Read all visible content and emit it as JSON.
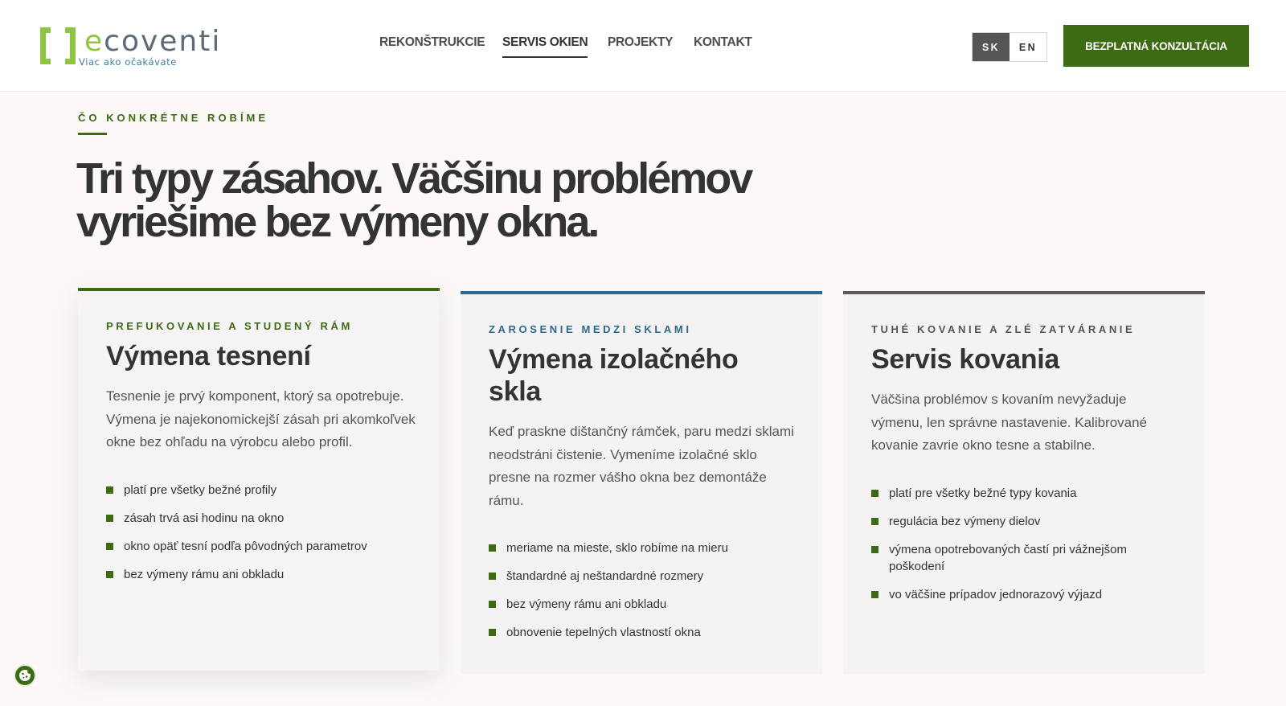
{
  "brand": {
    "logo_word_accent": "e",
    "logo_word_rest": "coventi",
    "tagline": "Viac ako očakávate",
    "colors": {
      "green": "#3d6b12",
      "lime": "#8dc63f",
      "blue": "#2b6a8e",
      "gray": "#5a5a5a"
    }
  },
  "nav": {
    "items": [
      {
        "label": "REKONŠTRUKCIE",
        "active": false
      },
      {
        "label": "SERVIS OKIEN",
        "active": true
      },
      {
        "label": "PROJEKTY",
        "active": false
      },
      {
        "label": "KONTAKT",
        "active": false
      }
    ]
  },
  "language": {
    "sk": "SK",
    "en": "EN",
    "selected": "SK"
  },
  "cta": {
    "label": "BEZPLATNÁ KONZULTÁCIA"
  },
  "section": {
    "eyebrow": "ČO KONKRÉTNE ROBÍME",
    "headline": "Tri typy zásahov. Väčšinu problémov vyriešime bez výmeny okna."
  },
  "cards": [
    {
      "eyebrow": "PREFUKOVANIE A STUDENÝ RÁM",
      "title": "Výmena tesnení",
      "text": "Tesnenie je prvý komponent, ktorý sa opotrebuje. Výmena je najekonomickejší zásah pri akomkoľvek okne bez ohľadu na výrobcu alebo profil.",
      "bullets": [
        "platí pre všetky bežné profily",
        "zásah trvá asi hodinu na okno",
        "okno opäť tesní podľa pôvodných parametrov",
        "bez výmeny rámu ani obkladu"
      ]
    },
    {
      "eyebrow": "ZAROSENIE MEDZI SKLAMI",
      "title": "Výmena izolačného skla",
      "text": "Keď praskne dištančný rámček, paru medzi sklami neodstráni čistenie. Vymeníme izolačné sklo presne na rozmer vášho okna bez demontáže rámu.",
      "bullets": [
        "meriame na mieste, sklo robíme na mieru",
        "štandardné aj neštandardné rozmery",
        "bez výmeny rámu ani obkladu",
        "obnovenie tepelných vlastností okna"
      ]
    },
    {
      "eyebrow": "TUHÉ KOVANIE A ZLÉ ZATVÁRANIE",
      "title": "Servis kovania",
      "text": "Väčšina problémov s kovaním nevyžaduje výmenu, len správne nastavenie. Kalibrované kovanie zavrie okno tesne a stabilne.",
      "bullets": [
        "platí pre všetky bežné typy kovania",
        "regulácia bez výmeny dielov",
        "výmena opotrebovaných častí pri vážnejšom poškodení",
        "vo väčšine prípadov jednorazový výjazd"
      ]
    }
  ],
  "icons": {
    "logo": "ecoventi-logo-mark",
    "cookie": "cookie-icon",
    "bullet": "square-bullet-icon"
  }
}
